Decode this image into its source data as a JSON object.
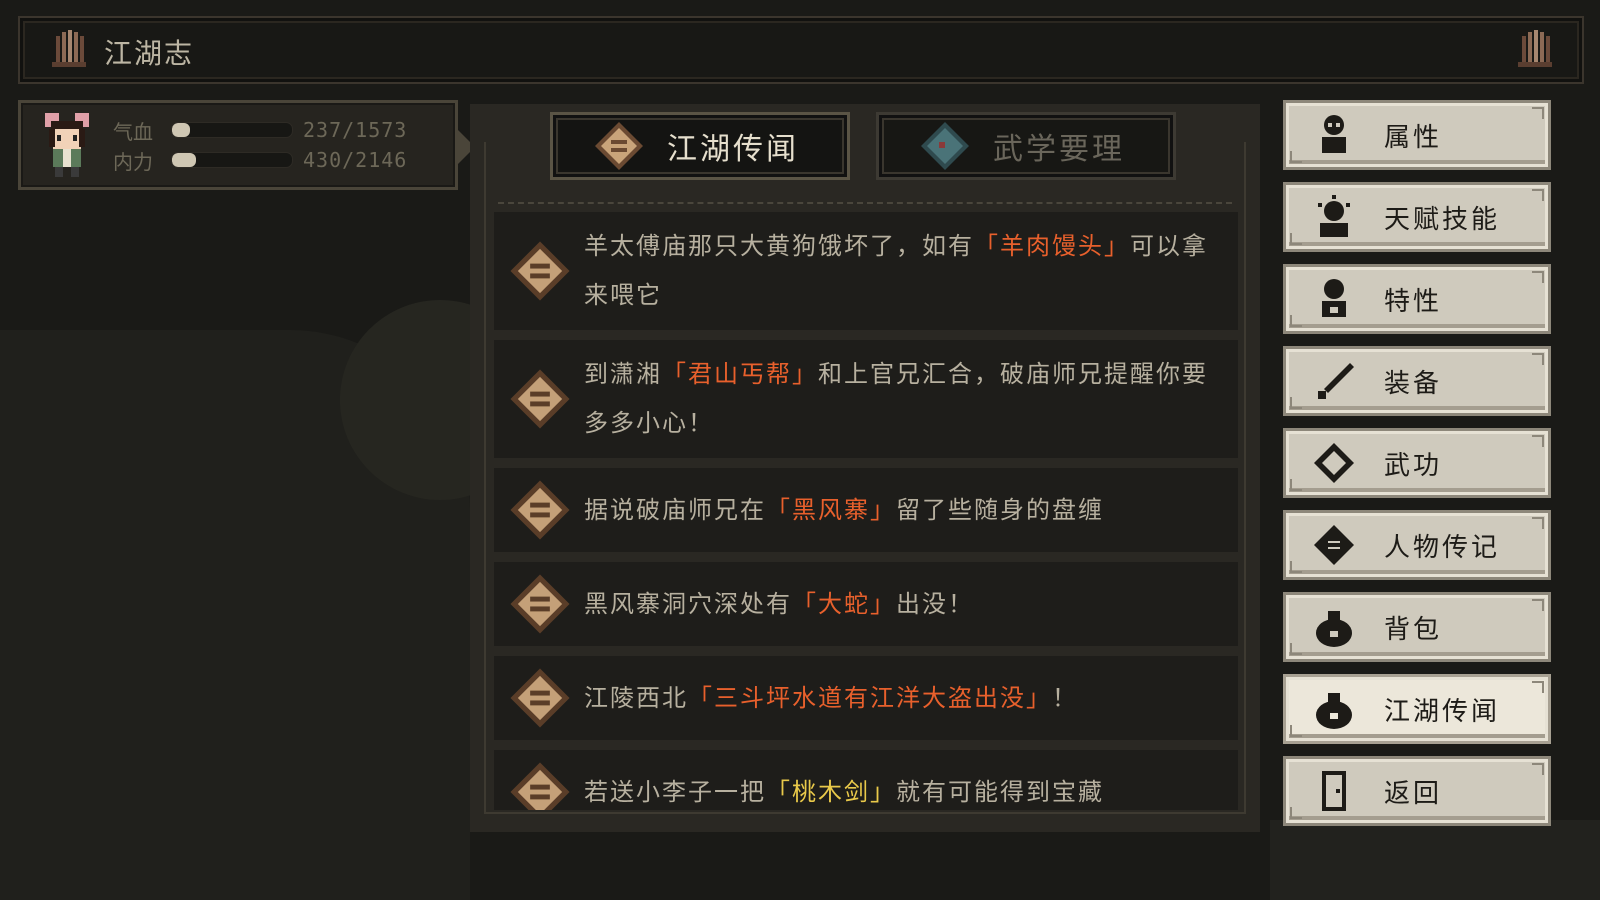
{
  "window": {
    "title": "江湖志"
  },
  "character": {
    "hp": {
      "label": "气血",
      "current": 237,
      "max": 1573,
      "display": "237/1573",
      "fraction": 0.15
    },
    "mp": {
      "label": "内力",
      "current": 430,
      "max": 2146,
      "display": "430/2146",
      "fraction": 0.2
    }
  },
  "tabs": [
    {
      "label": "江湖传闻",
      "active": true,
      "icon": "scroll-icon"
    },
    {
      "label": "武学要理",
      "active": false,
      "icon": "martial-manual-icon"
    }
  ],
  "news": [
    {
      "segments": [
        {
          "t": "羊太傅庙那只大黄狗饿坏了，如有"
        },
        {
          "t": "「羊肉馒头」",
          "hl": "orange"
        },
        {
          "t": "可以拿来喂它"
        }
      ]
    },
    {
      "segments": [
        {
          "t": "到潇湘"
        },
        {
          "t": "「君山丐帮」",
          "hl": "orange"
        },
        {
          "t": "和上官兄汇合，破庙师兄提醒你要多多小心！"
        }
      ]
    },
    {
      "segments": [
        {
          "t": "据说破庙师兄在"
        },
        {
          "t": "「黑风寨」",
          "hl": "orange"
        },
        {
          "t": "留了些随身的盘缠"
        }
      ]
    },
    {
      "segments": [
        {
          "t": "黑风寨洞穴深处有"
        },
        {
          "t": "「大蛇」",
          "hl": "orange"
        },
        {
          "t": "出没！"
        }
      ]
    },
    {
      "segments": [
        {
          "t": "江陵西北"
        },
        {
          "t": "「三斗坪水道有江洋大盗出没」",
          "hl": "orange"
        },
        {
          "t": "！"
        }
      ]
    },
    {
      "segments": [
        {
          "t": "若送小李子一把"
        },
        {
          "t": "「桃木剑」",
          "hl": "yellow"
        },
        {
          "t": "就有可能得到宝藏"
        }
      ]
    }
  ],
  "menu": [
    {
      "label": "属性",
      "icon": "attribute-figure-icon",
      "selected": false
    },
    {
      "label": "天赋技能",
      "icon": "talent-figure-icon",
      "selected": false
    },
    {
      "label": "特性",
      "icon": "trait-figure-icon",
      "selected": false
    },
    {
      "label": "装备",
      "icon": "sword-icon",
      "selected": false
    },
    {
      "label": "武功",
      "icon": "martial-book-icon",
      "selected": false
    },
    {
      "label": "人物传记",
      "icon": "biography-book-icon",
      "selected": false
    },
    {
      "label": "背包",
      "icon": "bag-icon",
      "selected": false
    },
    {
      "label": "江湖传闻",
      "icon": "rumor-bag-icon",
      "selected": true
    },
    {
      "label": "返回",
      "icon": "door-icon",
      "selected": false
    }
  ],
  "colors": {
    "highlight": "#e8602c",
    "highlight_yellow": "#e9c94a",
    "panel": "#2a2823",
    "button": "#cfcabd"
  }
}
